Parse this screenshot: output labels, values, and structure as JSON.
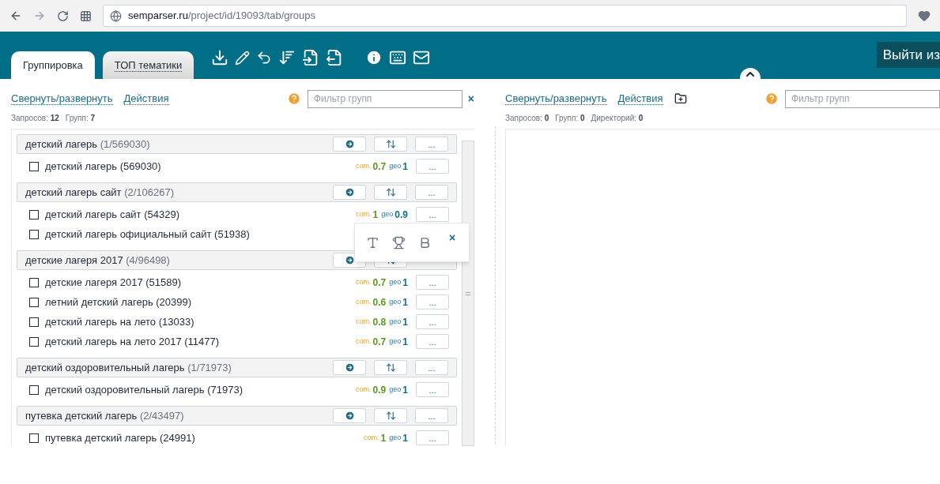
{
  "browser": {
    "url_host": "semparser.ru",
    "url_path": "/project/id/19093/tab/groups"
  },
  "header": {
    "tabs": [
      {
        "label": "Группировка",
        "selected": true
      },
      {
        "label": "ТОП тематики",
        "selected": false
      }
    ],
    "logout": "Выйти из"
  },
  "left": {
    "links": [
      "Свернуть/развернуть",
      "Действия"
    ],
    "filter": {
      "placeholder": "Фильтр групп"
    },
    "clear": "×",
    "stats": [
      {
        "label": "Запросов:",
        "value": "12"
      },
      {
        "label": "Групп:",
        "value": "7"
      }
    ],
    "groups": [
      {
        "name": "детский лагерь",
        "count": "(1/569030)",
        "more": "...",
        "items": [
          {
            "text": "детский лагерь (569030)",
            "checked": false,
            "com_label": "com.",
            "com": "0.7",
            "geo_label": "geo",
            "geo": "1",
            "more": "..."
          }
        ]
      },
      {
        "name": "детский лагерь сайт",
        "count": "(2/106267)",
        "more": "...",
        "items": [
          {
            "text": "детский лагерь сайт (54329)",
            "checked": false,
            "com_label": "com.",
            "com": "1",
            "geo_label": "geo",
            "geo": "0.9",
            "more": "..."
          },
          {
            "text": "детский лагерь официальный сайт (51938)",
            "checked": false
          }
        ]
      },
      {
        "name": "детские лагеря 2017",
        "count": "(4/96498)",
        "items": [
          {
            "text": "детские лагеря 2017 (51589)",
            "checked": false,
            "com_label": "com.",
            "com": "0.7",
            "geo_label": "geo",
            "geo": "1",
            "more": "..."
          },
          {
            "text": "летний детский лагерь (20399)",
            "checked": false,
            "com_label": "com.",
            "com": "0.6",
            "geo_label": "geo",
            "geo": "1",
            "more": "..."
          },
          {
            "text": "детский лагерь на лето (13033)",
            "checked": false,
            "com_label": "com.",
            "com": "0.8",
            "geo_label": "geo",
            "geo": "1",
            "more": "..."
          },
          {
            "text": "детский лагерь на лето 2017 (11477)",
            "checked": false,
            "com_label": "com.",
            "com": "0.7",
            "geo_label": "geo",
            "geo": "1",
            "more": "..."
          }
        ]
      },
      {
        "name": "детский оздоровительный лагерь",
        "count": "(1/71973)",
        "more": "...",
        "items": [
          {
            "text": "детский оздоровительный лагерь (71973)",
            "checked": false,
            "com_label": "com.",
            "com": "0.9",
            "geo_label": "geo",
            "geo": "1",
            "more": "..."
          }
        ]
      },
      {
        "name": "путевка детский лагерь",
        "count": "(2/43497)",
        "more": "...",
        "items": [
          {
            "text": "путевка детский лагерь (24991)",
            "checked": false,
            "com_label": "com.",
            "com": "1",
            "geo_label": "geo",
            "geo": "1",
            "more": "..."
          }
        ]
      }
    ],
    "popup": {
      "close": "×"
    }
  },
  "right": {
    "links": [
      "Свернуть/развернуть",
      "Действия"
    ],
    "filter": {
      "placeholder": "Фильтр групп"
    },
    "stats": [
      {
        "label": "Запросов:",
        "value": "0"
      },
      {
        "label": "Групп:",
        "value": "0"
      },
      {
        "label": "Директорий:",
        "value": "0"
      }
    ]
  }
}
